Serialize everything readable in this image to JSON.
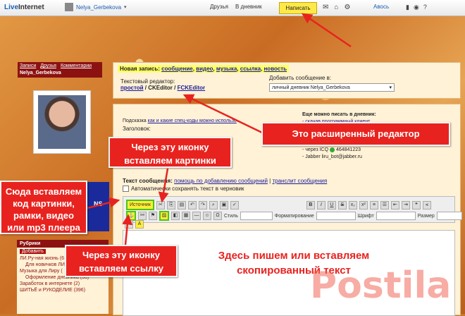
{
  "topbar": {
    "logo_part1": "Live",
    "logo_part2": "Internet",
    "username": "Nelya_Gerbekova",
    "link_friends": "Друзья",
    "link_diary": "В дневник",
    "write_button": "Написать",
    "avos": "Авось"
  },
  "profile": {
    "nav": [
      "Записи",
      "Друзья",
      "Комментарии"
    ],
    "name": "Nelya_Gerbekova"
  },
  "post_panel": {
    "new_post_label": "Новая запись:",
    "types": [
      "сообщение",
      "видео",
      "музыка",
      "ссылка",
      "новость"
    ],
    "editor_label": "Текстовый редактор:",
    "editor_simple": "простой",
    "editor_ck": "CKEditor",
    "editor_fck": "FCKEditor",
    "add_label": "Добавить сообщение в:",
    "add_select_value": "личный дневник Nelya_Gerbekova"
  },
  "form": {
    "hint_prefix": "Подсказка",
    "hint_link": "как и какие спец-коды можно использо",
    "subject_label": "Заголовок:",
    "also_label": "Еще можно писать в дневник:",
    "also_link1": "- скачав программный клиент",
    "icq": "- через ICQ",
    "icq_number": "464841223",
    "jabber": "- Jabber liru_bot@jabber.ru",
    "message_label": "Текст сообщения:",
    "help_link": "помощь по добавлению сообщений",
    "translit_link": "транслит сообщения",
    "autosave_label": "Автоматически сохранять текст в черновик",
    "source_button": "Источник",
    "style_label": "Стиль",
    "format_label": "Форматирование",
    "font_label": "Шрифт",
    "size_label": "Размер"
  },
  "rubrics": {
    "title": "Рубрики",
    "add": "Добавить",
    "items": [
      "ЛИ.Ру-ная жизнь (6",
      "Для новичков ЛИ.",
      "Музыка для Лиру (",
      "Оформление дневника (36)",
      "Заработок в интернете (2)",
      "ШИТЬЁ и РУКОДЕЛИЕ (396)"
    ]
  },
  "annotations": {
    "advanced_editor": "Это расширенный редактор",
    "image_icon_line1": "Через эту иконку",
    "image_icon_line2": "вставляем картинки",
    "code_line1": "Сюда вставляем",
    "code_line2": "код картинки,",
    "code_line3": "рамки, видео",
    "code_line4": "или mp3  плеера",
    "link_icon_line1": "Через эту иконку",
    "link_icon_line2": "вставляем ссылку",
    "write_here_line1": "Здесь пишем или вставляем",
    "write_here_line2": "скопированный текст",
    "watermark": "Postila"
  },
  "colors": {
    "callout": "#e8231f",
    "highlight": "#ffee33",
    "header_red": "#8c1212"
  }
}
